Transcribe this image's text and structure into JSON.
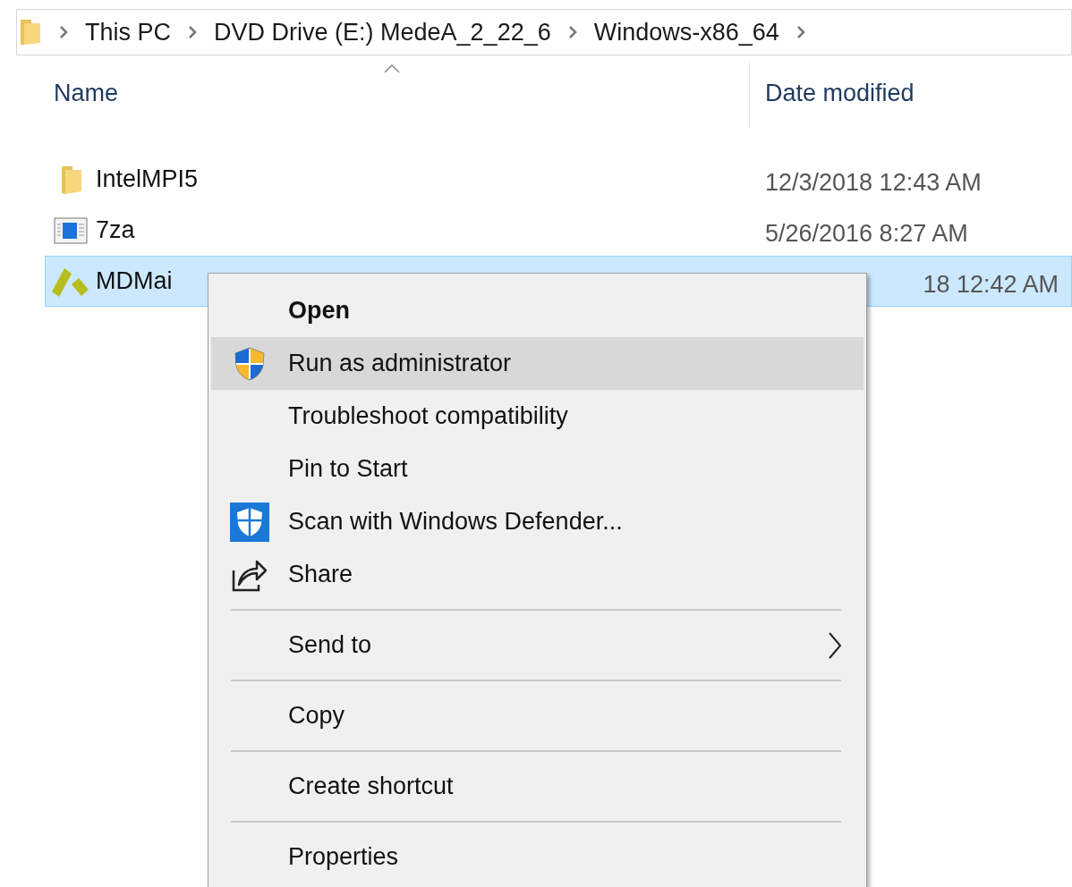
{
  "breadcrumb": [
    "This PC",
    "DVD Drive (E:) MedeA_2_22_6",
    "Windows-x86_64"
  ],
  "columns": [
    "Name",
    "Date modified"
  ],
  "rows": [
    {
      "name": "IntelMPI5",
      "date": "12/3/2018 12:43 AM",
      "kind": "folder",
      "selected": false
    },
    {
      "name": "7za",
      "date": "5/26/2016 8:27 AM",
      "kind": "program",
      "selected": false
    },
    {
      "name": "MDMai",
      "date": "18 12:42 AM",
      "kind": "application",
      "selected": true
    }
  ],
  "context_menu": [
    {
      "kind": "item",
      "label": "Open",
      "bold": true,
      "selected": false
    },
    {
      "kind": "admin",
      "label": "Run as administrator",
      "selected": true
    },
    {
      "kind": "item",
      "label": "Troubleshoot compatibility",
      "selected": false
    },
    {
      "kind": "item",
      "label": "Pin to Start",
      "selected": false
    },
    {
      "kind": "scan",
      "label": "Scan with Windows Defender...",
      "selected": false
    },
    {
      "kind": "share",
      "label": "Share",
      "selected": false
    },
    {
      "kind": "separator"
    },
    {
      "kind": "item",
      "label": "Send to",
      "submenu": true,
      "selected": false
    },
    {
      "kind": "separator"
    },
    {
      "kind": "item",
      "label": "Copy",
      "selected": false
    },
    {
      "kind": "separator"
    },
    {
      "kind": "item",
      "label": "Create shortcut",
      "selected": false
    },
    {
      "kind": "separator"
    },
    {
      "kind": "item",
      "label": "Properties",
      "selected": false
    }
  ]
}
